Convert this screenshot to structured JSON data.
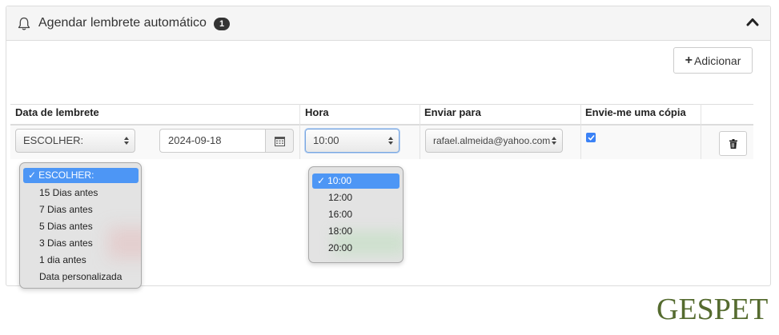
{
  "panel": {
    "title": "Agendar lembrete automático",
    "badge_count": "1",
    "bell_icon": "bell-icon",
    "collapse_icon": "chevron-up-icon"
  },
  "toolbar": {
    "add_label": "Adicionar",
    "add_icon": "plus-icon"
  },
  "table": {
    "columns": [
      "Data de lembrete",
      "Hora",
      "Enviar para",
      "Envie-me uma cópia"
    ],
    "row": {
      "reminder_select": "ESCOLHER:",
      "date_value": "2024-09-18",
      "calendar_icon": "calendar-icon",
      "time_select": "10:00",
      "recipient_select": "rafael.almeida@yahoo.com",
      "copy_checked": true,
      "delete_icon": "trash-icon"
    }
  },
  "reminder_dropdown": {
    "selected": "ESCOLHER:",
    "options": [
      "ESCOLHER:",
      "15 Dias antes",
      "7 Dias antes",
      "5 Dias antes",
      "3 Dias antes",
      "1 dia antes",
      "Data personalizada"
    ]
  },
  "time_dropdown": {
    "selected": "10:00",
    "options": [
      "10:00",
      "12:00",
      "16:00",
      "18:00",
      "20:00"
    ]
  },
  "logo": {
    "text": "GESPET"
  },
  "colors": {
    "selected_option": "#4d96f5",
    "checkbox": "#3b82f6",
    "logo": "#556b2f"
  }
}
